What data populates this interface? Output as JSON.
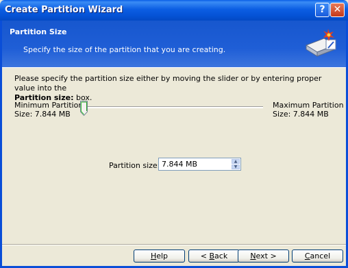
{
  "window": {
    "title": "Create Partition Wizard",
    "help_glyph": "?",
    "close_glyph": "✕"
  },
  "header": {
    "title": "Partition Size",
    "subtitle": "Specify the size of the partition that you are creating.",
    "icon": "disk-wizard-icon"
  },
  "body": {
    "instruction_part1": "Please specify the partition size either by moving the slider or by entering proper value into the",
    "instruction_bold": "Partition size:",
    "instruction_part2": " box.",
    "min_label_line1": "Minimum Partition",
    "min_label_line2": "Size: 7.844 MB",
    "max_label_line1": "Maximum Partition",
    "max_label_line2": "Size: 7.844 MB",
    "slider_position": 0,
    "partition_size_label": "Partition size:",
    "partition_size_value": "7.844 MB"
  },
  "buttons": {
    "help": {
      "pre": "",
      "mnemonic": "H",
      "post": "elp"
    },
    "back": {
      "pre": "< ",
      "mnemonic": "B",
      "post": "ack"
    },
    "next": {
      "pre": "",
      "mnemonic": "N",
      "post": "ext >"
    },
    "cancel": {
      "pre": "",
      "mnemonic": "C",
      "post": "ancel"
    }
  },
  "colors": {
    "titlebar": "#0A5EE6",
    "header": "#1F5ED6",
    "dialog_bg": "#ECE9D8"
  }
}
